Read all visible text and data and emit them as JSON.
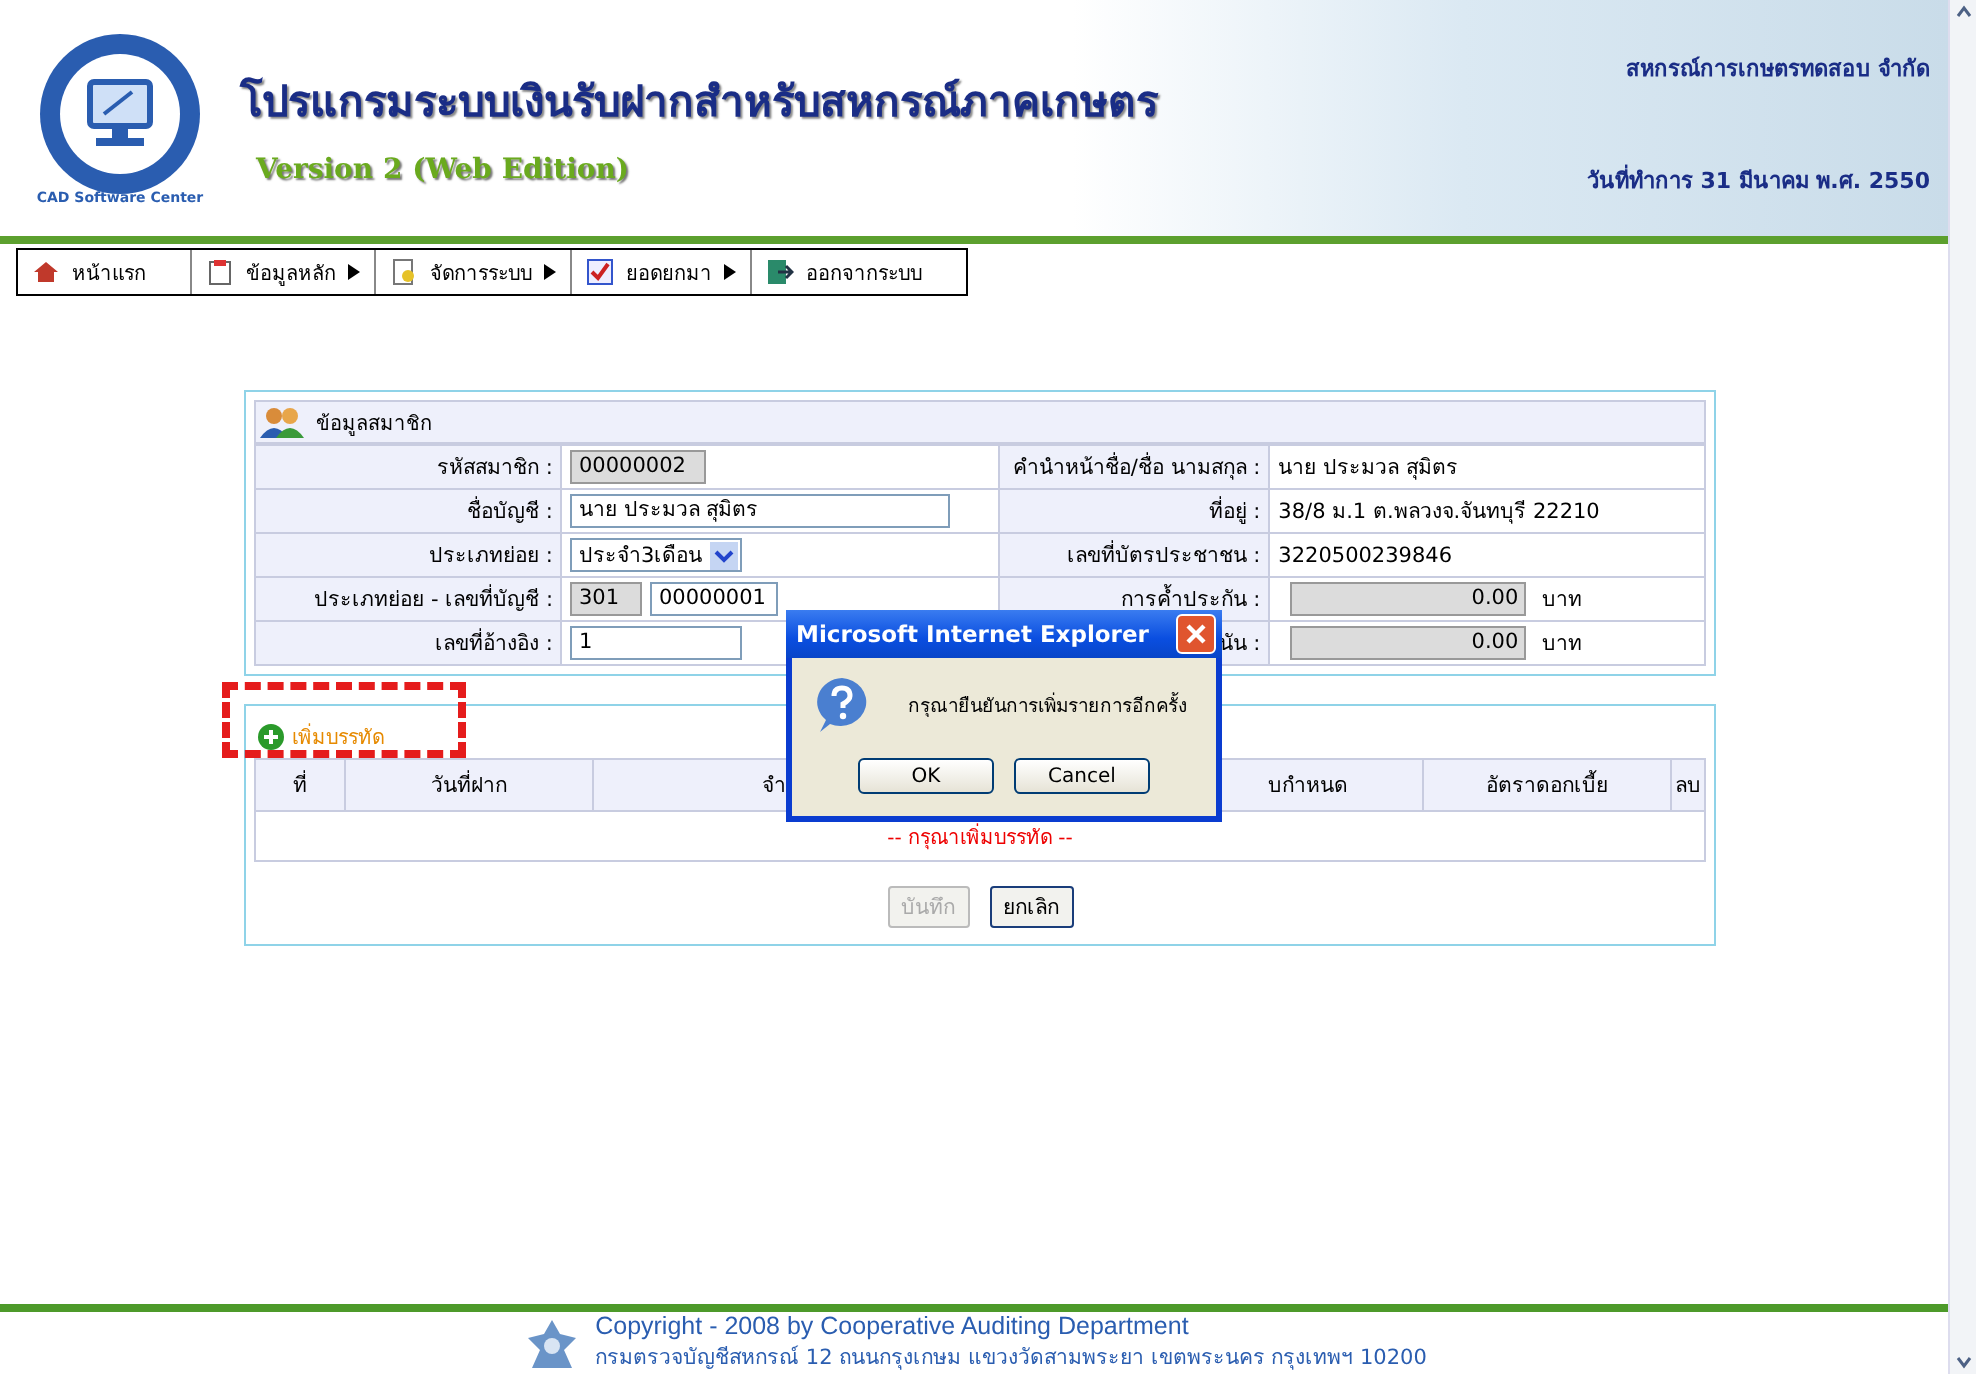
{
  "header": {
    "logo_text": "CAD Software Center",
    "title": "โปรแกรมระบบเงินรับฝากสำหรับสหกรณ์ภาคเกษตร",
    "subtitle": "Version 2 (Web Edition)",
    "organization": "สหกรณ์การเกษตรทดสอบ จำกัด",
    "work_date": "วันที่ทำการ 31 มีนาคม พ.ศ. 2550"
  },
  "menu": [
    {
      "label": "หน้าแรก",
      "kind": "home",
      "submenu": false
    },
    {
      "label": "ข้อมูลหลัก",
      "kind": "folder",
      "submenu": true
    },
    {
      "label": "จัดการระบบ",
      "kind": "doc",
      "submenu": true
    },
    {
      "label": "ยอดยกมา",
      "kind": "check",
      "submenu": true
    },
    {
      "label": "ออกจากระบบ",
      "kind": "exit",
      "submenu": false
    }
  ],
  "member_panel": {
    "title": "ข้อมูลสมาชิก",
    "rows": [
      {
        "left_label": "รหัสสมาชิก :",
        "left": {
          "kind": "readonly",
          "values": [
            "00000002"
          ]
        },
        "right_label": "คำนำหน้าชื่อ/ชื่อ นามสกุล :",
        "right": {
          "kind": "text",
          "value": "นาย ประมวล สุมิตร"
        }
      },
      {
        "left_label": "ชื่อบัญชี :",
        "left": {
          "kind": "input",
          "values": [
            "นาย ประมวล สุมิตร"
          ]
        },
        "right_label": "ที่อยู่ :",
        "right": {
          "kind": "text",
          "value": "38/8 ม.1 ต.พลวงจ.จันทบุรี 22210"
        }
      },
      {
        "left_label": "ประเภทย่อย  :",
        "left": {
          "kind": "select",
          "values": [
            "ประจำ3เดือน"
          ]
        },
        "right_label": "เลขที่บัตรประชาชน :",
        "right": {
          "kind": "text",
          "value": "3220500239846"
        }
      },
      {
        "left_label": "ประเภทย่อย - เลขที่บัญชี :",
        "left": {
          "kind": "pair",
          "values": [
            "301",
            "00000001"
          ]
        },
        "right_label": "การค้ำประกัน :",
        "right": {
          "kind": "amount",
          "value": "0.00",
          "unit": "บาท"
        }
      },
      {
        "left_label": "เลขที่อ้างอิง :",
        "left": {
          "kind": "input",
          "values": [
            "1"
          ]
        },
        "right_label": "นัน :",
        "right": {
          "kind": "amount",
          "value": "0.00",
          "unit": "บาท"
        }
      }
    ]
  },
  "deposit_panel": {
    "add_link": "เพิ่มบรรทัด",
    "columns": [
      "ที่",
      "วันที่ฝาก",
      "จำ",
      "บกำหนด",
      "อัตราดอกเบี้ย",
      "ลบ"
    ],
    "empty_message": "-- กรุณาเพิ่มบรรทัด --",
    "buttons": [
      {
        "label": "บันทึก",
        "disabled": true
      },
      {
        "label": "ยกเลิก",
        "disabled": false
      }
    ]
  },
  "dialog": {
    "title": "Microsoft Internet Explorer",
    "message": "กรุณายืนยันการเพิ่มรายการอีกครั้ง",
    "buttons": [
      "OK",
      "Cancel"
    ]
  },
  "footer": {
    "copyright": "Copyright - 2008 by Cooperative Auditing Department",
    "address": "กรมตรวจบัญชีสหกรณ์ 12 ถนนกรุงเกษม แขวงวัดสามพระยา เขตพระนคร กรุงเทพฯ 10200"
  }
}
